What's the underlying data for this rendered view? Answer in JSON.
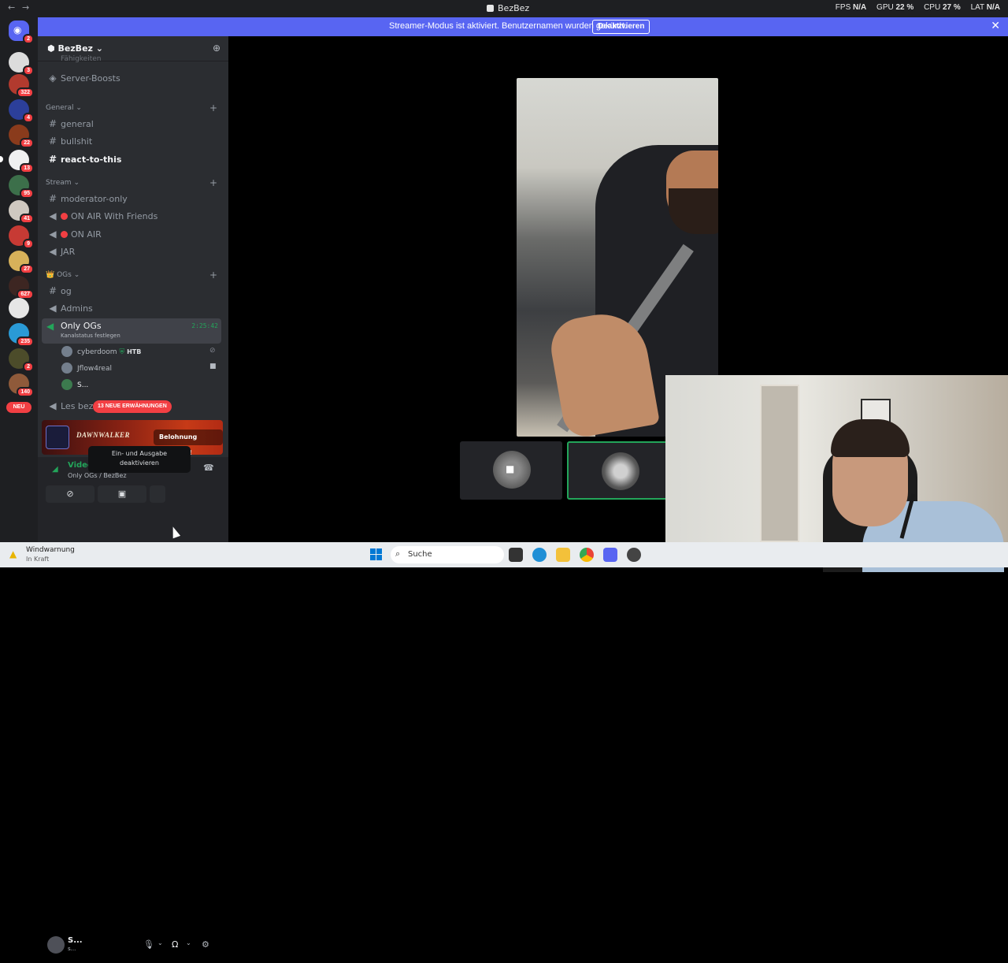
{
  "window": {
    "title": "BezBez",
    "back": "←",
    "forward": "→"
  },
  "perf": {
    "fps_label": "FPS",
    "fps": "N/A",
    "gpu_label": "GPU",
    "gpu": "22 %",
    "cpu_label": "CPU",
    "cpu": "27 %",
    "lat_label": "LAT",
    "lat": "N/A"
  },
  "banner": {
    "message": "Streamer-Modus ist aktiviert. Benutzernamen wurden gekürzt.",
    "button": "Deaktivieren"
  },
  "rail": {
    "badges": [
      "2",
      "3",
      "322",
      "4",
      "22",
      "13",
      "95",
      "41",
      "9",
      "27",
      "627",
      "235",
      "2",
      "140"
    ],
    "new_label": "NEU"
  },
  "server": {
    "name": "BezBez"
  },
  "channels": {
    "top_partial": "Fähigkeiten",
    "server_boosts": "Server-Boosts",
    "cat_general": "General",
    "general": "general",
    "bullshit": "bullshit",
    "react": "react-to-this",
    "cat_stream": "Stream",
    "moderator": "moderator-only",
    "on_air_friends": "ON AIR With Friends",
    "on_air": "ON AIR",
    "jar": "JAR",
    "cat_ogs": "OGs",
    "og": "og",
    "admins": "Admins",
    "only_ogs": "Only OGs",
    "only_ogs_status": "Kanalstatus festlegen",
    "only_ogs_time": "2:25:42",
    "les": "Les bezb",
    "mentions": "13 NEUE ERWÄHNUNGEN"
  },
  "voice_users": [
    {
      "name": "cyberdoom",
      "tag": "HTB"
    },
    {
      "name": "Jflow4real"
    },
    {
      "name": "S..."
    }
  ],
  "promo": {
    "game": "DAWNWALKER",
    "button": "Belohnung erhalten!"
  },
  "voice": {
    "status": "Video verbunden",
    "channel": "Only OGs / BezBez"
  },
  "tooltip": {
    "line1": "Ein- und Ausgabe",
    "line2": "deaktivieren"
  },
  "user": {
    "name": "S...",
    "status": "s..."
  },
  "taskbar": {
    "weather_title": "Windwarnung",
    "weather_sub": "In Kraft",
    "search": "Suche"
  },
  "colors": {
    "accent": "#5865f2",
    "online": "#23a55a",
    "danger": "#f23f43"
  }
}
